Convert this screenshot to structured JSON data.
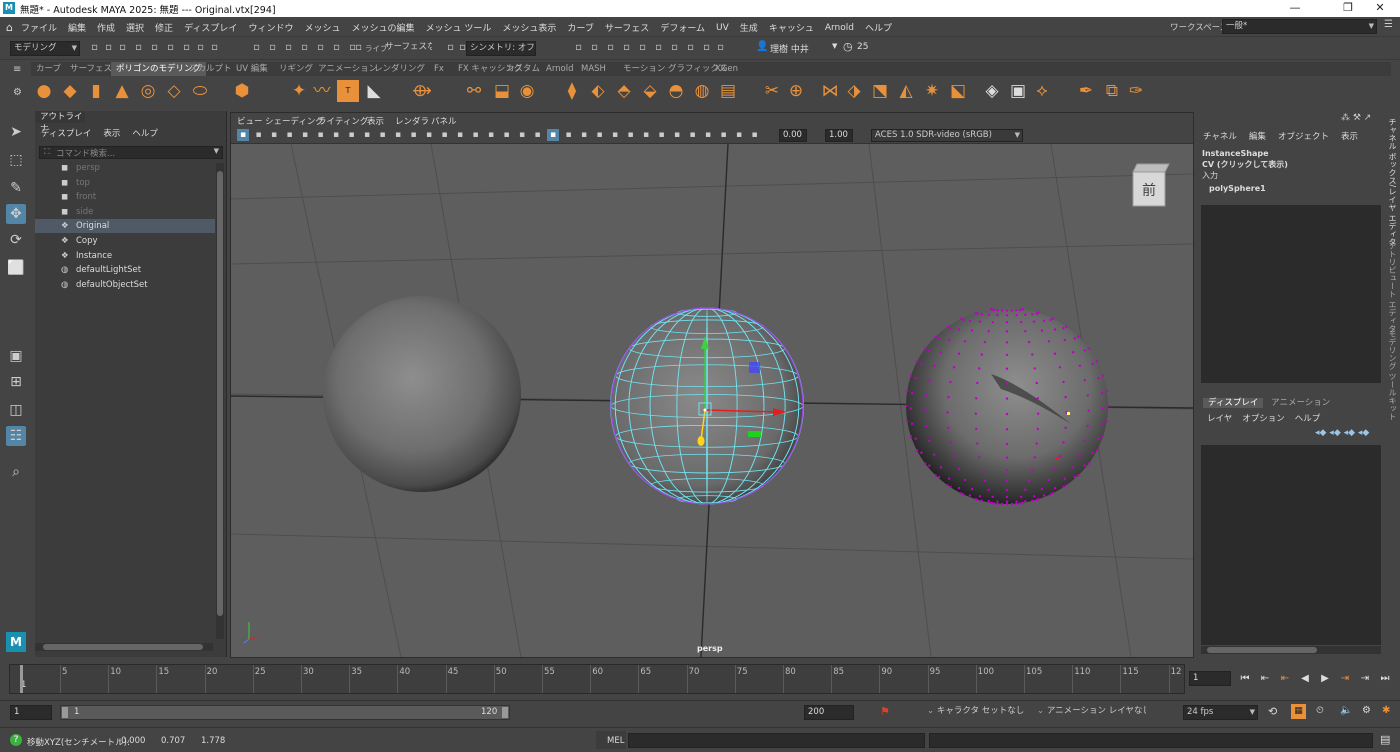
{
  "title_bar": {
    "app_icon": "M",
    "title": "無題* - Autodesk MAYA 2025: 無題   ---   Original.vtx[294]",
    "min": "—",
    "max": "❐",
    "close": "✕"
  },
  "menubar": {
    "items": [
      "ファイル",
      "編集",
      "作成",
      "選択",
      "修正",
      "ディスプレイ",
      "ウィンドウ",
      "メッシュ",
      "メッシュの編集",
      "メッシュ ツール",
      "メッシュ表示",
      "カーブ",
      "サーフェス",
      "デフォーム",
      "UV",
      "生成",
      "キャッシュ",
      "Arnold",
      "ヘルプ"
    ],
    "workspace_label": "ワークスペース :",
    "workspace_value": "一般*"
  },
  "statusline": {
    "mode": "モデリング",
    "live_label": "ライブ",
    "live_value": "サーフェスなし",
    "symmetry": "シンメトリ: オフ",
    "user": "理樹 中井",
    "counter": "25"
  },
  "shelf": {
    "tabs": [
      "カーブ",
      "サーフェス",
      "ポリゴンのモデリング",
      "スカルプト",
      "UV 編集",
      "リギング",
      "アニメーション",
      "レンダリング",
      "Fx",
      "FX キャッシング",
      "カスタム",
      "Arnold",
      "MASH",
      "モーション グラフィックス",
      "XGen"
    ],
    "active_tab": "ポリゴンのモデリング"
  },
  "outliner": {
    "tab": "アウトライナ",
    "menu": [
      "ディスプレイ",
      "表示",
      "ヘルプ"
    ],
    "search_placeholder": "コマンド検索...",
    "items": [
      {
        "label": "persp",
        "icon": "camera-icon",
        "dim": true
      },
      {
        "label": "top",
        "icon": "camera-icon",
        "dim": true
      },
      {
        "label": "front",
        "icon": "camera-icon",
        "dim": true
      },
      {
        "label": "side",
        "icon": "camera-icon",
        "dim": true
      },
      {
        "label": "Original",
        "icon": "mesh-icon",
        "dim": false,
        "selected": true
      },
      {
        "label": "Copy",
        "icon": "mesh-icon",
        "dim": false
      },
      {
        "label": "Instance",
        "icon": "mesh-icon",
        "dim": false
      },
      {
        "label": "defaultLightSet",
        "icon": "set-icon",
        "dim": false
      },
      {
        "label": "defaultObjectSet",
        "icon": "set-icon",
        "dim": false
      }
    ]
  },
  "viewport": {
    "menu": [
      "ビュー",
      "シェーディング",
      "ライティング",
      "表示",
      "レンダラ",
      "パネル"
    ],
    "exposure": "0.00",
    "gamma": "1.00",
    "color_space": "ACES 1.0 SDR-video (sRGB)",
    "camera_label": "persp",
    "viewcube_label": "前"
  },
  "channel_box": {
    "menu": [
      "チャネル",
      "編集",
      "オブジェクト",
      "表示"
    ],
    "shape": "InstanceShape",
    "cv_label": "CV (クリックして表示)",
    "input_label": "入力",
    "input_node": "polySphere1"
  },
  "layer_editor": {
    "tabs": [
      "ディスプレイ",
      "アニメーション"
    ],
    "menu": [
      "レイヤ",
      "オプション",
      "ヘルプ"
    ]
  },
  "side_tabs": [
    "チャネル ボックス/レイヤ エディタ",
    "アトリビュート エディタ",
    "モデリング ツールキット"
  ],
  "timeline": {
    "ticks": [
      "5",
      "10",
      "15",
      "20",
      "25",
      "30",
      "35",
      "40",
      "45",
      "50",
      "55",
      "60",
      "65",
      "70",
      "75",
      "80",
      "85",
      "90",
      "95",
      "100",
      "105",
      "110",
      "115",
      "12"
    ],
    "start_label": "1",
    "current_frame": "1"
  },
  "range": {
    "start": "1",
    "inner_start": "1",
    "inner_end": "120",
    "end": "200",
    "character_set": "キャラクタ セットなし",
    "anim_layer": "アニメーション レイヤなし",
    "fps": "24 fps"
  },
  "command_line": {
    "status": "移動XYZ(センチメートル):",
    "x": "-0.000",
    "y": "0.707",
    "z": "1.778",
    "lang": "MEL"
  },
  "colors": {
    "accent": "#5285a6",
    "shelf_icon": "#e8913a",
    "wire_cyan": "#6fe3ef",
    "vertex_magenta": "#c000c8"
  }
}
